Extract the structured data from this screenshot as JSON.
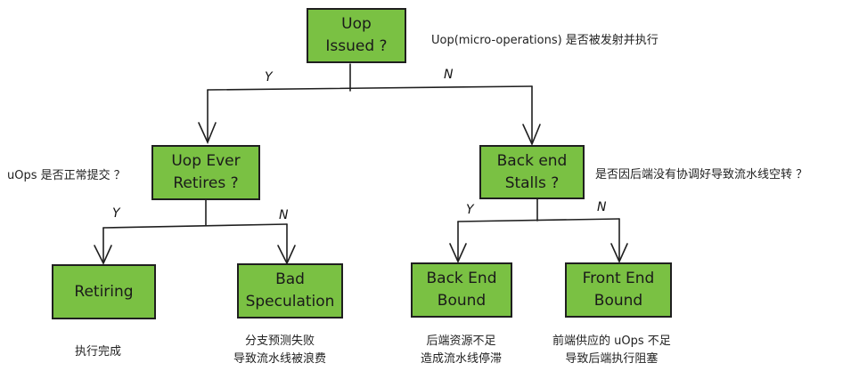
{
  "nodes": {
    "issued": "Uop\nIssued ?",
    "ever_retires": "Uop Ever\nRetires ?",
    "backend_stalls": "Back end\nStalls ?",
    "retiring": "Retiring",
    "bad_speculation": "Bad\nSpeculation",
    "backend_bound": "Back End\nBound",
    "frontend_bound": "Front End\nBound"
  },
  "branches": {
    "yes": "Y",
    "no": "N"
  },
  "notes": {
    "issued": "Uop(micro-operations) 是否被发射并执行",
    "ever_retires": "uOps 是否正常提交 ？",
    "backend_stalls": "是否因后端没有协调好导致流水线空转 ？",
    "retiring": "执行完成",
    "bad_speculation": "分支预测失败\n导致流水线被浪费",
    "backend_bound": "后端资源不足\n造成流水线停滞",
    "frontend_bound": "前端供应的 uOps 不足\n导致后端执行阻塞"
  },
  "colors": {
    "box_fill": "#7ac143",
    "stroke": "#1f1f1f"
  }
}
